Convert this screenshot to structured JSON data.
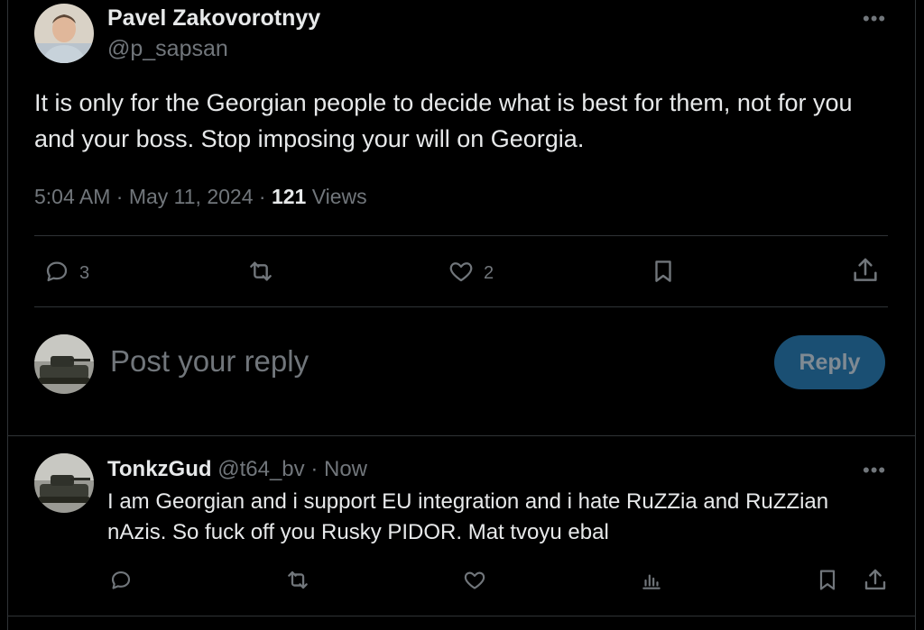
{
  "tweet": {
    "author_name": "Pavel Zakovorotnyy",
    "author_handle": "@p_sapsan",
    "text": "It is only for the Georgian people to decide what is best for them, not for you and your boss. Stop imposing your will on Georgia.",
    "time": "5:04 AM",
    "date": "May 11, 2024",
    "views_count": "121",
    "views_label": "Views",
    "reply_count": "3",
    "like_count": "2",
    "more_icon": "more-dots-icon"
  },
  "composer": {
    "placeholder": "Post your reply",
    "reply_label": "Reply"
  },
  "reply": {
    "author_name": "TonkzGud",
    "author_handle": "@t64_bv",
    "time": "Now",
    "text": "I am Georgian and i support EU integration and i hate RuZZia and RuZZian nAzis. So fuck off you Rusky PIDOR. Mat tvoyu ebal"
  },
  "colors": {
    "background": "#000000",
    "text": "#e7e9ea",
    "secondary": "#71767b",
    "divider": "#2f3336",
    "reply_button": "#1a4f73"
  }
}
